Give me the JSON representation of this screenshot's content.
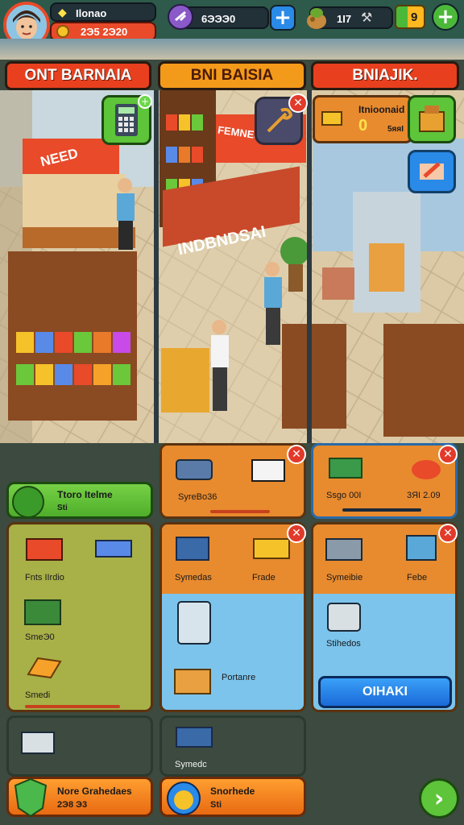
{
  "hud": {
    "player_name": "Ilonao",
    "player_money": "2Э5  2Э20",
    "gems_value": "6ЭЭЭ0",
    "energy_value": "1I7",
    "level_value": "9"
  },
  "tabs": [
    "ONT BARNAIA",
    "BNI BAISIA",
    "BNIAJIK."
  ],
  "scene": {
    "store_sign_left": "NEED",
    "store_sign_mid": "INDBNDSAI",
    "store_sign_top": "FEMNESIE"
  },
  "left_column": {
    "green_card": {
      "title": "Ttoro Itelme",
      "subtitle": "Sti"
    },
    "items": [
      "Fnts IIrdio",
      "SmeЭ0",
      "Smedi"
    ],
    "bottom_item": "",
    "orange_card": {
      "title": "Nore Grahedaes",
      "subtitle": "2Э8  Э3"
    }
  },
  "mid_column": {
    "top_panel_label": "SyreBo36",
    "items": [
      "Symedas",
      "Frade",
      "Portanre"
    ],
    "bottom_item": "Symedc",
    "orange_card": {
      "title": "Snorhede",
      "subtitle": "Sti"
    }
  },
  "right_column": {
    "info_panel": {
      "title": "Itnioonaid",
      "value": "0",
      "small": "5яяI"
    },
    "top_panel_labels": [
      "Ssgo 00I",
      "3ЯI 2.09"
    ],
    "items": [
      "Symeibie",
      "Febe",
      "Stihedos"
    ],
    "action_button": "OIHAKI"
  },
  "colors": {
    "tab_red": "#e8401e",
    "tab_orange": "#f49a1a",
    "panel_orange": "#e88a2e",
    "panel_blue": "#7cc4ec",
    "green": "#5ec43a"
  }
}
